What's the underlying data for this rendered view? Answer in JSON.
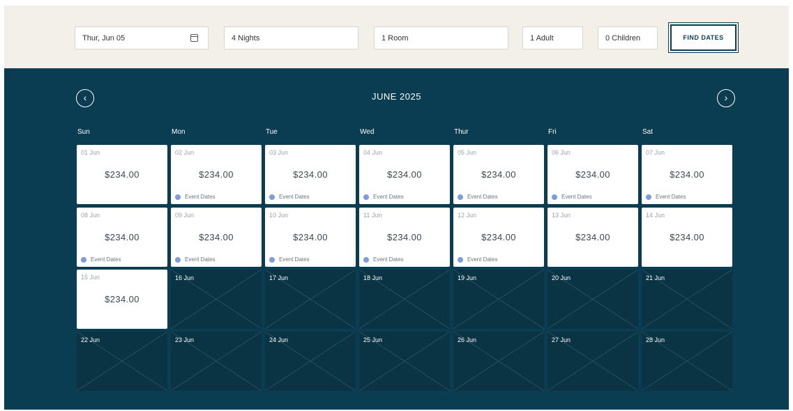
{
  "search": {
    "check_in": "Thur, Jun 05",
    "nights": "4 Nights",
    "rooms": "1 Room",
    "adults": "1 Adult",
    "children": "0 Children",
    "find_label": "FIND DATES"
  },
  "calendar": {
    "month_title": "JUNE 2025",
    "prev_icon": "chevron-left-icon",
    "next_icon": "chevron-right-icon",
    "prev_symbol": "‹",
    "next_symbol": "›",
    "weekdays": [
      "Sun",
      "Mon",
      "Tue",
      "Wed",
      "Thur",
      "Fri",
      "Sat"
    ],
    "event_label": "Event Dates",
    "event_color": "#7c9ce0",
    "weeks": [
      [
        {
          "date": "01 Jun",
          "price": "$234.00",
          "event": false,
          "available": true
        },
        {
          "date": "02 Jun",
          "price": "$234.00",
          "event": true,
          "available": true
        },
        {
          "date": "03 Jun",
          "price": "$234.00",
          "event": true,
          "available": true
        },
        {
          "date": "04 Jun",
          "price": "$234.00",
          "event": true,
          "available": true
        },
        {
          "date": "05 Jun",
          "price": "$234.00",
          "event": true,
          "available": true
        },
        {
          "date": "06 Jun",
          "price": "$234.00",
          "event": true,
          "available": true
        },
        {
          "date": "07 Jun",
          "price": "$234.00",
          "event": true,
          "available": true
        }
      ],
      [
        {
          "date": "08 Jun",
          "price": "$234.00",
          "event": true,
          "available": true
        },
        {
          "date": "09 Jun",
          "price": "$234.00",
          "event": true,
          "available": true
        },
        {
          "date": "10 Jun",
          "price": "$234.00",
          "event": true,
          "available": true
        },
        {
          "date": "11 Jun",
          "price": "$234.00",
          "event": true,
          "available": true
        },
        {
          "date": "12 Jun",
          "price": "$234.00",
          "event": true,
          "available": true
        },
        {
          "date": "13 Jun",
          "price": "$234.00",
          "event": false,
          "available": true
        },
        {
          "date": "14 Jun",
          "price": "$234.00",
          "event": false,
          "available": true
        }
      ],
      [
        {
          "date": "15 Jun",
          "price": "$234.00",
          "event": false,
          "available": true
        },
        {
          "date": "16 Jun",
          "price": "",
          "event": false,
          "available": false
        },
        {
          "date": "17 Jun",
          "price": "",
          "event": false,
          "available": false
        },
        {
          "date": "18 Jun",
          "price": "",
          "event": false,
          "available": false
        },
        {
          "date": "19 Jun",
          "price": "",
          "event": false,
          "available": false
        },
        {
          "date": "20 Jun",
          "price": "",
          "event": false,
          "available": false
        },
        {
          "date": "21 Jun",
          "price": "",
          "event": false,
          "available": false
        }
      ],
      [
        {
          "date": "22 Jun",
          "price": "",
          "event": false,
          "available": false
        },
        {
          "date": "23 Jun",
          "price": "",
          "event": false,
          "available": false
        },
        {
          "date": "24 Jun",
          "price": "",
          "event": false,
          "available": false
        },
        {
          "date": "25 Jun",
          "price": "",
          "event": false,
          "available": false
        },
        {
          "date": "26 Jun",
          "price": "",
          "event": false,
          "available": false
        },
        {
          "date": "27 Jun",
          "price": "",
          "event": false,
          "available": false
        },
        {
          "date": "28 Jun",
          "price": "",
          "event": false,
          "available": false
        }
      ]
    ]
  }
}
